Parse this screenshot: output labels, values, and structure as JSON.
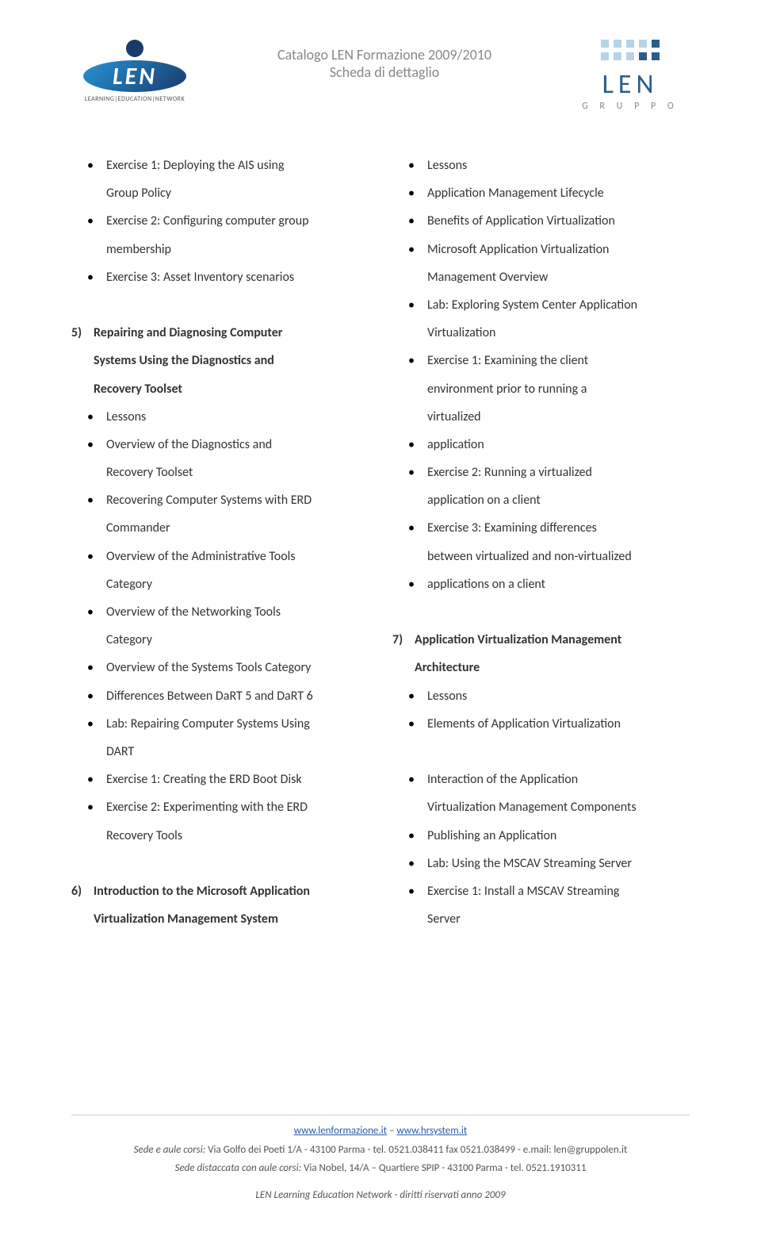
{
  "header": {
    "title_line1": "Catalogo LEN Formazione 2009/2010",
    "title_line2": "Scheda di dettaglio",
    "logo_left_text": "LEN",
    "logo_left_tagline": "LEARNING|EDUCATION|NETWORK",
    "logo_right_text": "LEN",
    "logo_right_sub": "G R U P P O"
  },
  "left": {
    "ex1": "Exercise 1: Deploying the AIS using",
    "ex1b": "Group Policy",
    "ex2": "Exercise 2: Configuring computer group",
    "ex2b": "membership",
    "ex3": "Exercise 3: Asset Inventory scenarios",
    "s5_num": "5)",
    "s5_title_a": "Repairing and Diagnosing Computer",
    "s5_title_b": "Systems Using the Diagnostics and",
    "s5_title_c": "Recovery Toolset",
    "s5_1": "Lessons",
    "s5_2a": "Overview of the Diagnostics and",
    "s5_2b": "Recovery Toolset",
    "s5_3a": "Recovering Computer Systems with ERD",
    "s5_3b": "Commander",
    "s5_4a": "Overview of the Administrative Tools",
    "s5_4b": "Category",
    "s5_5a": "Overview of the Networking Tools",
    "s5_5b": "Category",
    "s5_6": "Overview of the Systems Tools Category",
    "s5_7": "Differences Between DaRT 5 and DaRT 6",
    "s5_8a": "Lab: Repairing Computer Systems Using",
    "s5_8b": "DART",
    "s5_9": "Exercise 1: Creating the ERD Boot Disk",
    "s5_10a": "Exercise 2: Experimenting with the ERD",
    "s5_10b": "Recovery Tools",
    "s6_num": "6)",
    "s6_title_a": "Introduction to the Microsoft Application",
    "s6_title_b": "Virtualization Management System"
  },
  "right": {
    "r1": "Lessons",
    "r2": "Application Management Lifecycle",
    "r3": "Benefits of Application Virtualization",
    "r4a": "Microsoft Application Virtualization",
    "r4b": "Management Overview",
    "r5a": "Lab: Exploring System Center Application",
    "r5b": "Virtualization",
    "r6a": "Exercise 1: Examining the client",
    "r6b": "environment prior to running a",
    "r6c": "virtualized",
    "r7": "application",
    "r8a": "Exercise 2: Running a virtualized",
    "r8b": "application on a client",
    "r9a": "Exercise 3: Examining differences",
    "r9b": "between virtualized and non-virtualized",
    "r10": "applications on a client",
    "s7_num": "7)",
    "s7_title_a": "Application Virtualization Management",
    "s7_title_b": "Architecture",
    "s7_1": "Lessons",
    "s7_2": "Elements of Application Virtualization",
    "s7_3a": "Interaction of the Application",
    "s7_3b": "Virtualization Management Components",
    "s7_4": "Publishing an Application",
    "s7_5": "Lab: Using the MSCAV Streaming Server",
    "s7_6a": "Exercise 1: Install a MSCAV Streaming",
    "s7_6b": "Server"
  },
  "footer": {
    "link1": "www.lenformazione.it",
    "dash": " – ",
    "link2": "www.hrsystem.it",
    "line2a": "Sede e aule corsi:",
    "line2b": " Via Golfo dei Poeti 1/A - 43100 Parma - tel. 0521.038411 fax 0521.038499 - e.mail: len@gruppolen.it",
    "line3a": "Sede distaccata con aule corsi:",
    "line3b": " Via Nobel, 14/A – Quartiere SPIP - 43100 Parma - tel. 0521.1910311",
    "line4": "LEN Learning Education Network - diritti riservati anno 2009"
  }
}
